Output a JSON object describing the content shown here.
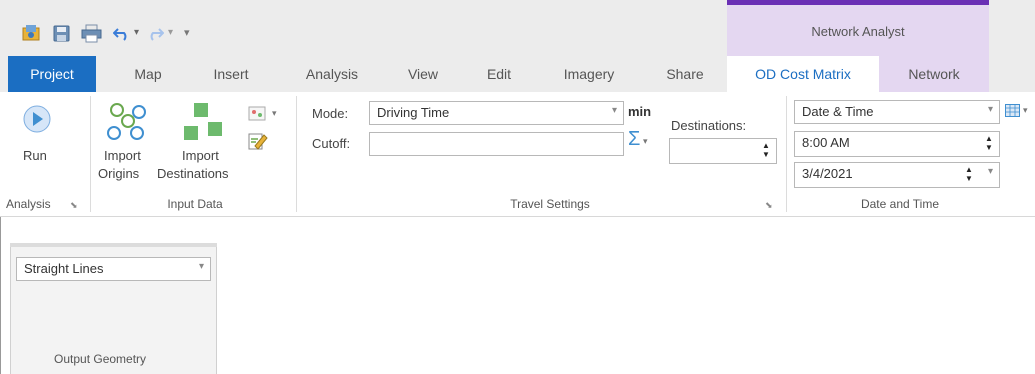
{
  "contextual_tab_group": {
    "label": "Network Analyst"
  },
  "quick_access": {
    "icons": [
      "project-icon",
      "save-icon",
      "print-icon",
      "undo-icon",
      "redo-icon",
      "customize-icon"
    ]
  },
  "tabs": [
    {
      "label": "Project",
      "state": "active-app"
    },
    {
      "label": "Map"
    },
    {
      "label": "Insert"
    },
    {
      "label": "Analysis"
    },
    {
      "label": "View"
    },
    {
      "label": "Edit"
    },
    {
      "label": "Imagery"
    },
    {
      "label": "Share"
    },
    {
      "label": "OD Cost Matrix",
      "state": "selected"
    },
    {
      "label": "Network"
    }
  ],
  "groups": {
    "analysis": {
      "label": "Analysis",
      "run_label": "Run"
    },
    "input_data": {
      "label": "Input Data",
      "import_origins": [
        "Import",
        "Origins"
      ],
      "import_destinations": [
        "Import",
        "Destinations"
      ]
    },
    "travel_settings": {
      "label": "Travel Settings",
      "mode_label": "Mode:",
      "mode_value": "Driving Time",
      "unit_label": "min",
      "cutoff_label": "Cutoff:",
      "cutoff_value": "",
      "destinations_label": "Destinations:",
      "destinations_value": "",
      "sum_symbol": "Σ"
    },
    "date_and_time": {
      "label": "Date and Time",
      "type_value": "Date & Time",
      "time_value": "8:00 AM",
      "date_value": "3/4/2021"
    },
    "output_geometry": {
      "label": "Output Geometry",
      "value": "Straight Lines"
    }
  },
  "colors": {
    "accent_blue": "#1b6ec2",
    "contextual_purple": "#6a2fb5",
    "contextual_bg": "#e4d7f1",
    "ribbon_bg": "#ececec",
    "run_button": "#4a90d9",
    "geometry_green": "#6dba6d",
    "origin_blue": "#3f8fd0"
  }
}
